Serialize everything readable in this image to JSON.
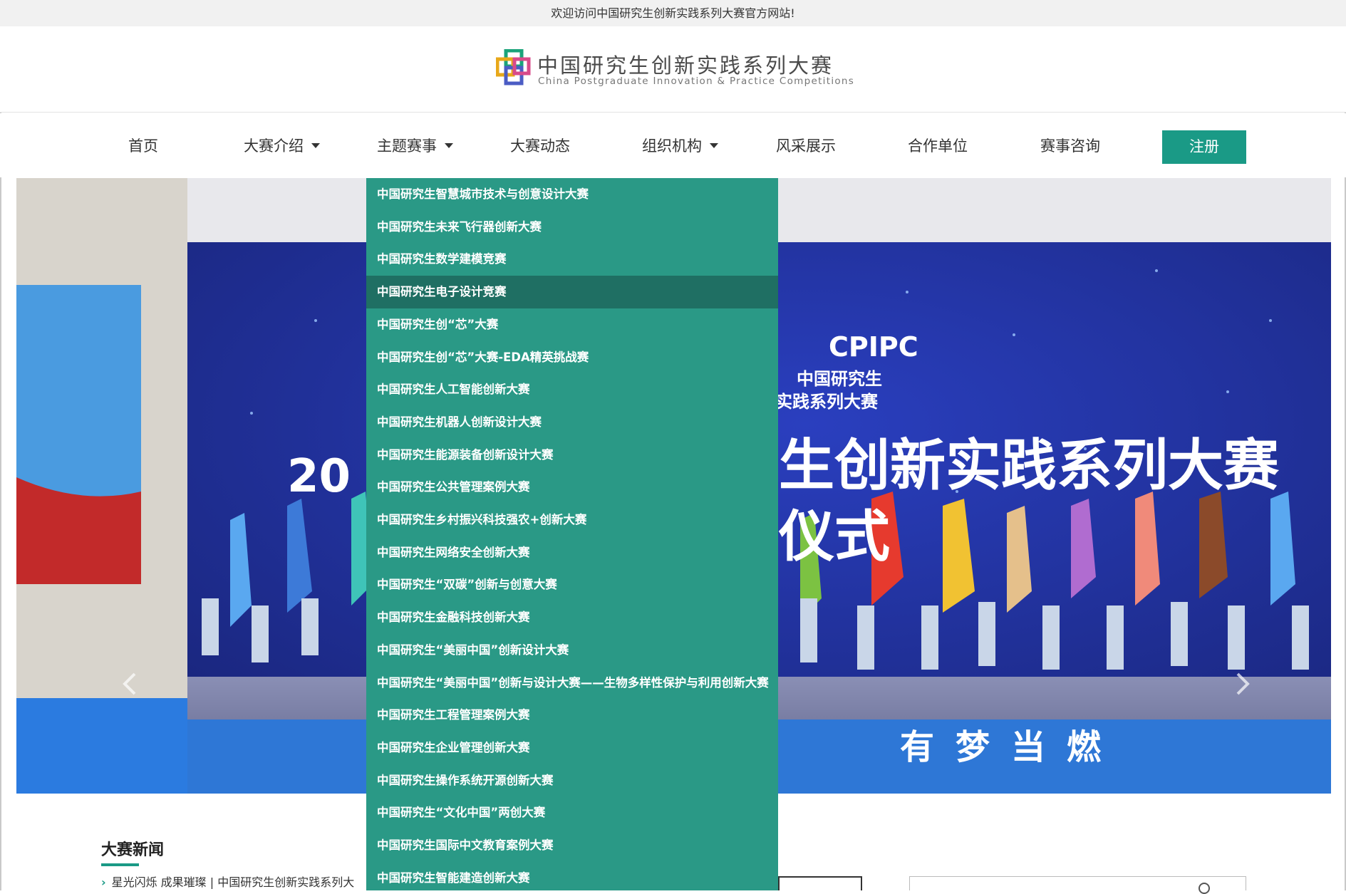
{
  "topbar": {
    "welcome": "欢迎访问中国研究生创新实践系列大赛官方网站!"
  },
  "logo": {
    "cn": "中国研究生创新实践系列大赛",
    "en": "China Postgraduate Innovation & Practice Competitions"
  },
  "nav": {
    "items": [
      {
        "label": "首页",
        "has_dropdown": false
      },
      {
        "label": "大赛介绍",
        "has_dropdown": true
      },
      {
        "label": "主题赛事",
        "has_dropdown": true
      },
      {
        "label": "大赛动态",
        "has_dropdown": false
      },
      {
        "label": "组织机构",
        "has_dropdown": true
      },
      {
        "label": "风采展示",
        "has_dropdown": false
      },
      {
        "label": "合作单位",
        "has_dropdown": false
      },
      {
        "label": "赛事咨询",
        "has_dropdown": false
      }
    ],
    "register": "注册"
  },
  "banner": {
    "cpipc": "CPIPC",
    "cn_line1": "中国研究生",
    "cn_line2": "实践系列大赛",
    "headline": "生创新实践系列大赛",
    "headline2": "仪式",
    "footer_slogan": "有梦当燃",
    "year_fragment": "20"
  },
  "dropdown": {
    "items": [
      "中国研究生智慧城市技术与创意设计大赛",
      "中国研究生未来飞行器创新大赛",
      "中国研究生数学建模竞赛",
      "中国研究生电子设计竞赛",
      "中国研究生创“芯”大赛",
      "中国研究生创“芯”大赛-EDA精英挑战赛",
      "中国研究生人工智能创新大赛",
      "中国研究生机器人创新设计大赛",
      "中国研究生能源装备创新设计大赛",
      "中国研究生公共管理案例大赛",
      "中国研究生乡村振兴科技强农+创新大赛",
      "中国研究生网络安全创新大赛",
      "中国研究生“双碳”创新与创意大赛",
      "中国研究生金融科技创新大赛",
      "中国研究生“美丽中国”创新设计大赛",
      "中国研究生“美丽中国”创新与设计大赛——生物多样性保护与利用创新大赛",
      "中国研究生工程管理案例大赛",
      "中国研究生企业管理创新大赛",
      "中国研究生操作系统开源创新大赛",
      "中国研究生“文化中国”两创大赛",
      "中国研究生国际中文教育案例大赛",
      "中国研究生智能建造创新大赛"
    ],
    "active_index": 3
  },
  "news": {
    "title": "大赛新闻",
    "first_item": "星光闪烁 成果璀璨 | 中国研究生创新实践系列大"
  },
  "colors": {
    "accent": "#1a9a86",
    "dropdown_bg": "#2a9986",
    "dropdown_active": "#1f6f63"
  }
}
